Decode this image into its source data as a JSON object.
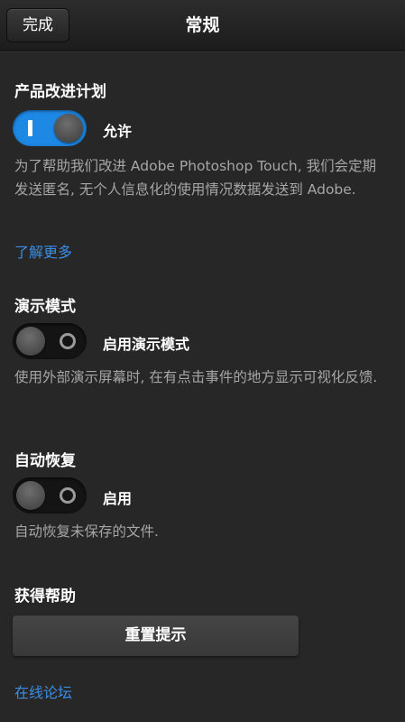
{
  "header": {
    "done_label": "完成",
    "title": "常规"
  },
  "improvement": {
    "heading": "产品改进计划",
    "toggle_label": "允许",
    "toggle_on": true,
    "description": "为了帮助我们改进 Adobe Photoshop Touch, 我们会定期发送匿名, 无个人信息化的使用情况数据发送到 Adobe.",
    "learn_more": "了解更多"
  },
  "demo_mode": {
    "heading": "演示模式",
    "toggle_label": "启用演示模式",
    "toggle_on": false,
    "description": "使用外部演示屏幕时, 在有点击事件的地方显示可视化反馈."
  },
  "auto_recovery": {
    "heading": "自动恢复",
    "toggle_label": "启用",
    "toggle_on": false,
    "description": "自动恢复未保存的文件."
  },
  "help": {
    "heading": "获得帮助",
    "reset_tips_label": "重置提示",
    "forum_link": "在线论坛"
  },
  "colors": {
    "background": "#272727",
    "accent_blue": "#1e88e5",
    "link_blue": "#3b8ee6",
    "secondary_text": "#a6a6a6"
  }
}
